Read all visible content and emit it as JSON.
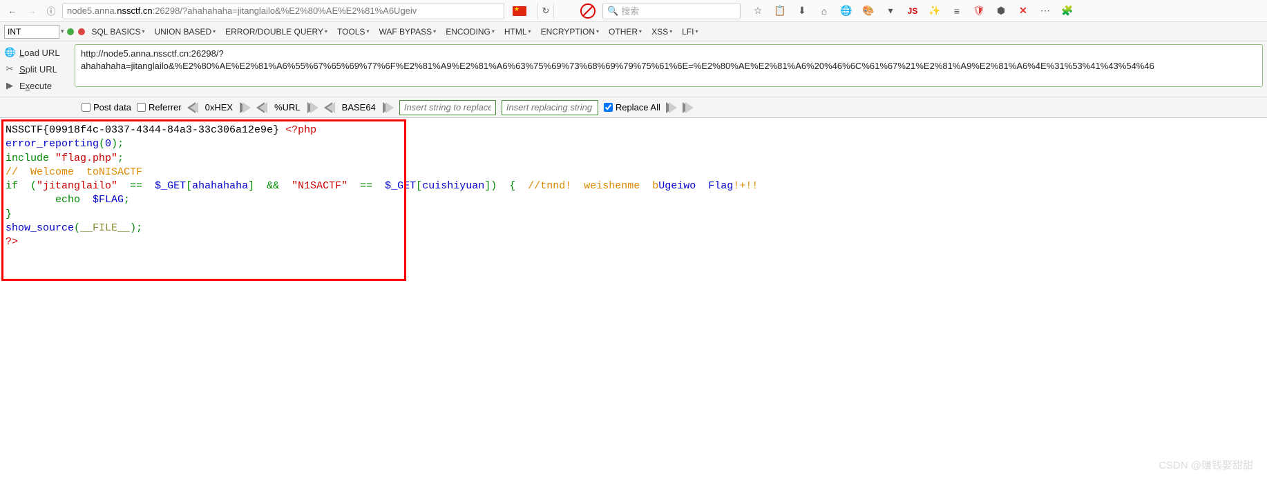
{
  "browser": {
    "url_prefix": "node5.anna.",
    "url_host": "nssctf.cn",
    "url_suffix": ":26298/?ahahahaha=jitanglailo&%E2%80%AE%E2%81%A6Ugeiv",
    "search_placeholder": "搜索",
    "icons": [
      "star",
      "clipboard",
      "download",
      "home",
      "globe",
      "palette",
      "menu",
      "JS",
      "wand",
      "bars",
      "shield",
      "ublock",
      "X",
      "more",
      "puzzle"
    ]
  },
  "hackbar": {
    "int_label": "INT",
    "menu": [
      "SQL BASICS",
      "UNION BASED",
      "ERROR/DOUBLE QUERY",
      "TOOLS",
      "WAF BYPASS",
      "ENCODING",
      "HTML",
      "ENCRYPTION",
      "OTHER",
      "XSS",
      "LFI"
    ],
    "actions": {
      "load": "Load URL",
      "split": "Split URL",
      "execute": "Execute"
    },
    "full_url": "http://node5.anna.nssctf.cn:26298/?ahahahaha=jitanglailo&%E2%80%AE%E2%81%A6%55%67%65%69%77%6F%E2%81%A9%E2%81%A6%63%75%69%73%68%69%79%75%61%6E=%E2%80%AE%E2%81%A6%20%46%6C%61%67%21%E2%81%A9%E2%81%A6%4E%31%53%41%43%54%46",
    "encode": {
      "postdata": "Post data",
      "referrer": "Referrer",
      "hex": "0xHEX",
      "url": "%URL",
      "b64": "BASE64",
      "replace_find_ph": "Insert string to replace",
      "replace_with_ph": "Insert replacing string",
      "replace_all": "Replace All"
    }
  },
  "code": {
    "flag": "NSSCTF{09918f4c-0337-4344-84a3-33c306a12e9e}",
    "php_open": "<?php",
    "l2a": "error_reporting",
    "l2b": "(",
    "l2c": "0",
    "l2d": ");",
    "l3a": "include ",
    "l3b": "\"flag.php\"",
    "l3c": ";",
    "l4": "//  Welcome  toNISACTF",
    "l5a": "if  (",
    "l5b": "\"jitanglailo\"",
    "l5c": "  ==  ",
    "l5d": "$_GET",
    "l5e": "[",
    "l5f": "ahahahaha",
    "l5g": "]  &&  ",
    "l5h": "\"N1SACTF\"",
    "l5i": "  ==  ",
    "l5j": "$_GET",
    "l5k": "[",
    "l5l": "cuishiyuan",
    "l5m": "])  {  ",
    "l5n": "//tnnd!  weishenme  b",
    "l5o": "Ugeiwo  Flag",
    "l5p": "!+!!",
    "l6a": "        echo  ",
    "l6b": "$FLAG",
    "l6c": ";",
    "l7": "}",
    "l8a": "show_source",
    "l8b": "(",
    "l8c": "__FILE__",
    "l8d": ");",
    "l9": "?>"
  },
  "watermark": "CSDN @赚钱娶甜甜"
}
